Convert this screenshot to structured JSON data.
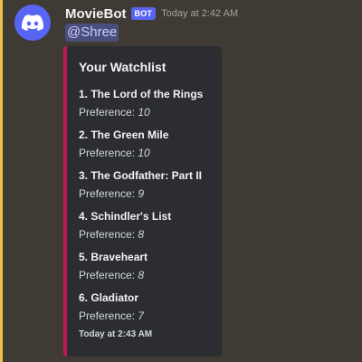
{
  "message": {
    "author": "MovieBot",
    "bot_tag": "BOT",
    "timestamp": "Today at 2:42 AM",
    "mention": "@Shree",
    "avatar_icon": "discord-logo-icon",
    "colors": {
      "avatar_bg": "#5865f2",
      "embed_accent": "#c2185b",
      "highlight": "#e8c04a"
    }
  },
  "embed": {
    "title": "Your Watchlist",
    "pref_label": "Preference: ",
    "items": [
      {
        "title": "1. The Lord of the Rings",
        "preference": "10"
      },
      {
        "title": "2. The Green Mile",
        "preference": "10"
      },
      {
        "title": "3. The Godfather: Part II",
        "preference": "9"
      },
      {
        "title": "4. Schindler's List",
        "preference": "8"
      },
      {
        "title": "5. Braveheart",
        "preference": "8"
      },
      {
        "title": "6. Gladiator",
        "preference": "7"
      }
    ],
    "footer": "Today at 2:43 AM"
  }
}
